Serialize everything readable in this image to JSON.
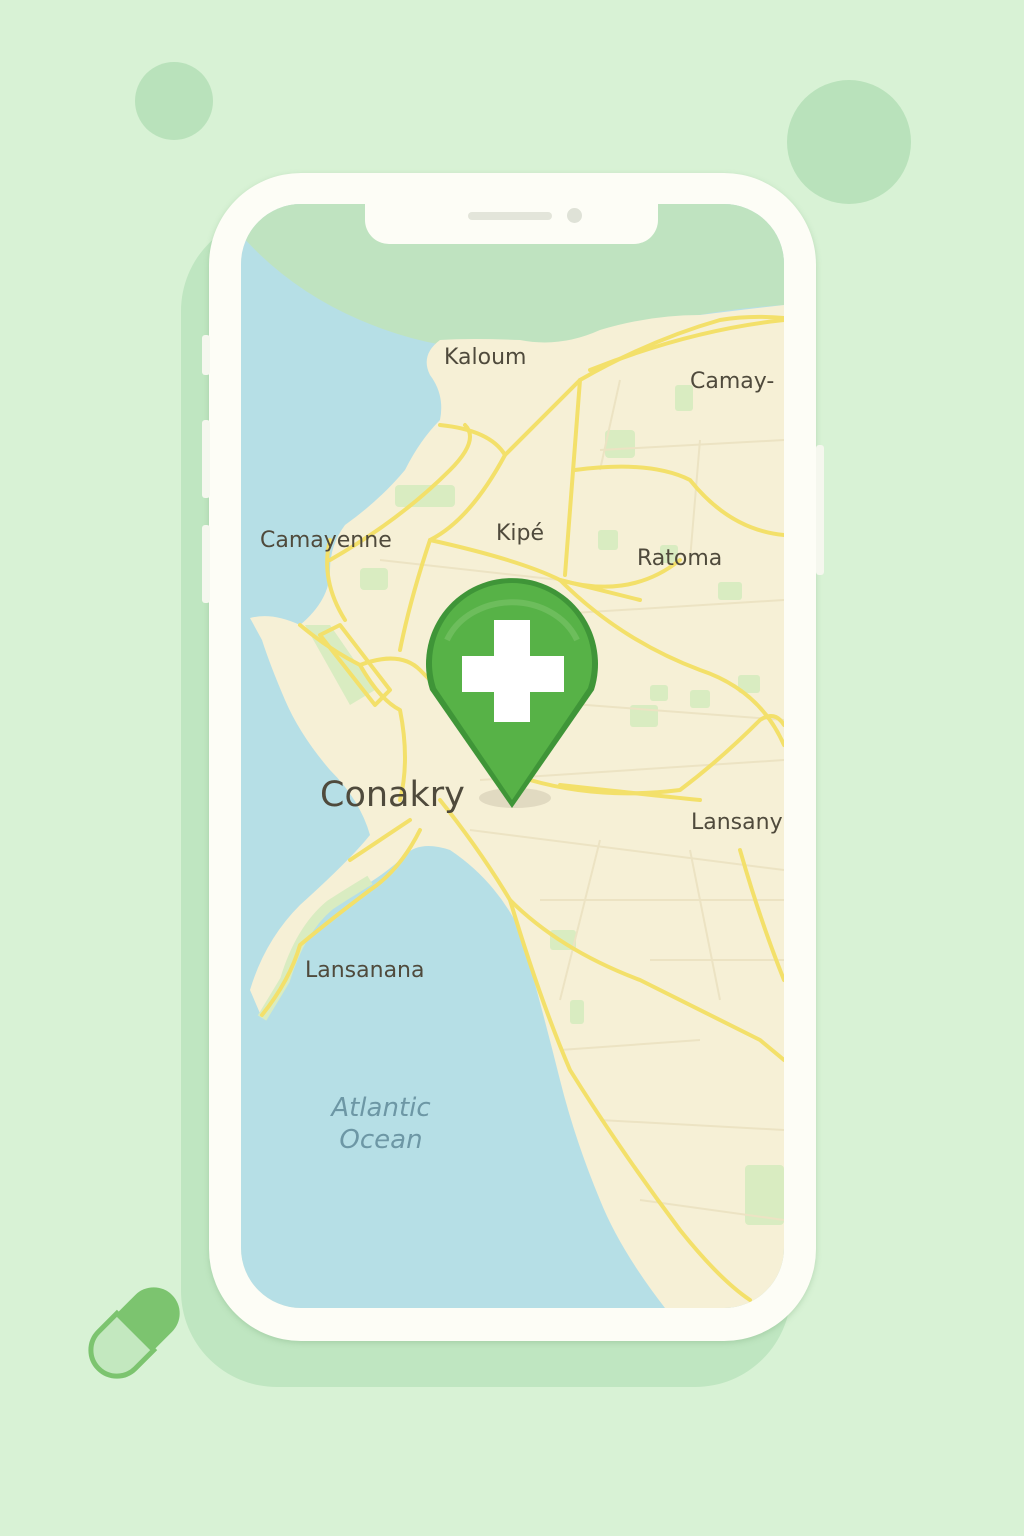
{
  "map": {
    "places": {
      "kaloum": "Kaloum",
      "camay": "Camay-",
      "camayenne": "Camayenne",
      "kipe": "Kipé",
      "ratoma": "Ratoma",
      "conakry": "Conakry",
      "lansany": "Lansany",
      "lansanana": "Lansanana"
    },
    "water": {
      "atlantic_line1": "Atlantic",
      "atlantic_line2": "Ocean"
    },
    "pin": {
      "icon": "pharmacy-cross-pin-icon",
      "color": "#57b247"
    }
  },
  "colors": {
    "background": "#d8f2d5",
    "water": "#b6dfe6",
    "land": "#f6f0d6",
    "roads": "#f3e06a",
    "parks": "#d9ecc1",
    "accent": "#57b247"
  },
  "decor": {
    "pill_icon": "capsule-icon"
  }
}
